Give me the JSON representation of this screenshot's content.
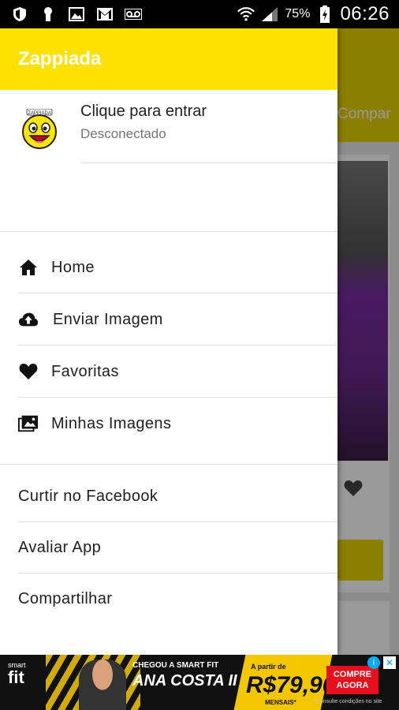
{
  "status_bar": {
    "battery_percent": "75%",
    "time": "06:26",
    "icons": [
      "shield-icon",
      "keyhole-icon",
      "image-icon",
      "gmail-icon",
      "voicemail-icon",
      "wifi-icon",
      "signal-icon",
      "battery-icon"
    ]
  },
  "app": {
    "title": "Zappiada",
    "accent_color": "#ffe100",
    "background_tab_partial": "Compar"
  },
  "profile": {
    "name": "Clique para entrar",
    "status": "Desconectado",
    "avatar": "smiley-logo"
  },
  "menu": {
    "items": [
      {
        "label": "Home",
        "icon": "home-icon"
      },
      {
        "label": "Enviar Imagem",
        "icon": "cloud-upload-icon"
      },
      {
        "label": "Favoritas",
        "icon": "heart-icon"
      },
      {
        "label": "Minhas Imagens",
        "icon": "images-icon"
      }
    ],
    "links": [
      {
        "label": "Curtir no Facebook"
      },
      {
        "label": "Avaliar App"
      },
      {
        "label": "Compartilhar"
      }
    ]
  },
  "ad": {
    "brand_small": "smart",
    "brand_big": "fit",
    "headline": "CHEGOU A SMART FIT",
    "location": "ANA COSTA II",
    "price_from": "A partir de",
    "price": "R$79,90",
    "price_note": "MENSAIS*",
    "cta": "COMPRE AGORA",
    "footnote": "*Consulte condições no site"
  }
}
